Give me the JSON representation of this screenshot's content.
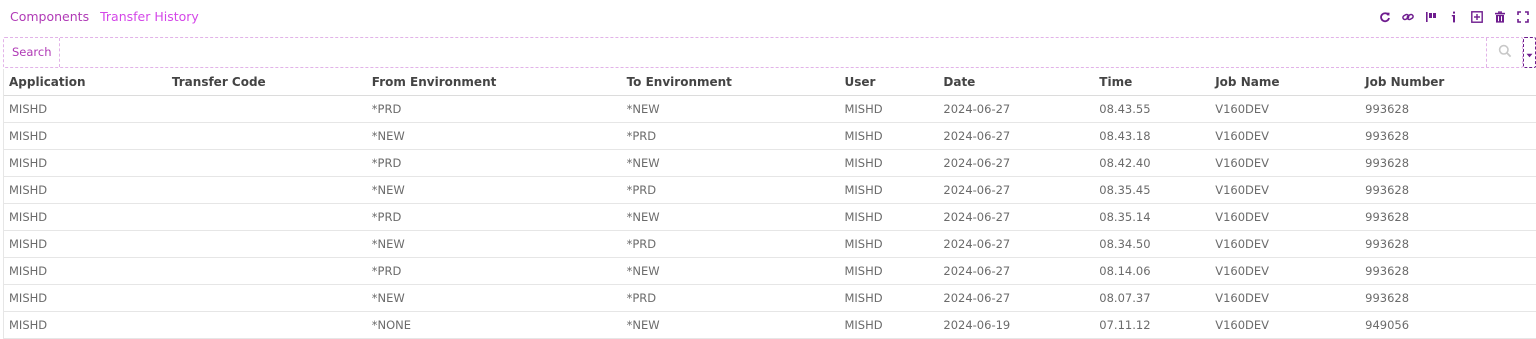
{
  "tabs": [
    {
      "label": "Components",
      "active": false
    },
    {
      "label": "Transfer History",
      "active": true
    }
  ],
  "toolbar": {
    "icons": [
      "refresh-icon",
      "link-icon",
      "flag-icon",
      "info-icon",
      "add-box-icon",
      "trash-icon",
      "fullscreen-icon"
    ]
  },
  "search": {
    "label": "Search",
    "value": "",
    "placeholder": ""
  },
  "colors": {
    "accent": "#d447e8",
    "accent_dark": "#b03ab6",
    "icon": "#6e1c8e",
    "border": "#e2b3e8"
  },
  "table": {
    "columns": [
      "Application",
      "Transfer Code",
      "From Environment",
      "To Environment",
      "User",
      "Date",
      "Time",
      "Job Name",
      "Job Number"
    ],
    "rows": [
      [
        "MISHD",
        "",
        "*PRD",
        "*NEW",
        "MISHD",
        "2024-06-27",
        "08.43.55",
        "V160DEV",
        "993628"
      ],
      [
        "MISHD",
        "",
        "*NEW",
        "*PRD",
        "MISHD",
        "2024-06-27",
        "08.43.18",
        "V160DEV",
        "993628"
      ],
      [
        "MISHD",
        "",
        "*PRD",
        "*NEW",
        "MISHD",
        "2024-06-27",
        "08.42.40",
        "V160DEV",
        "993628"
      ],
      [
        "MISHD",
        "",
        "*NEW",
        "*PRD",
        "MISHD",
        "2024-06-27",
        "08.35.45",
        "V160DEV",
        "993628"
      ],
      [
        "MISHD",
        "",
        "*PRD",
        "*NEW",
        "MISHD",
        "2024-06-27",
        "08.35.14",
        "V160DEV",
        "993628"
      ],
      [
        "MISHD",
        "",
        "*NEW",
        "*PRD",
        "MISHD",
        "2024-06-27",
        "08.34.50",
        "V160DEV",
        "993628"
      ],
      [
        "MISHD",
        "",
        "*PRD",
        "*NEW",
        "MISHD",
        "2024-06-27",
        "08.14.06",
        "V160DEV",
        "993628"
      ],
      [
        "MISHD",
        "",
        "*NEW",
        "*PRD",
        "MISHD",
        "2024-06-27",
        "08.07.37",
        "V160DEV",
        "993628"
      ],
      [
        "MISHD",
        "",
        "*NONE",
        "*NEW",
        "MISHD",
        "2024-06-19",
        "07.11.12",
        "V160DEV",
        "949056"
      ]
    ]
  }
}
